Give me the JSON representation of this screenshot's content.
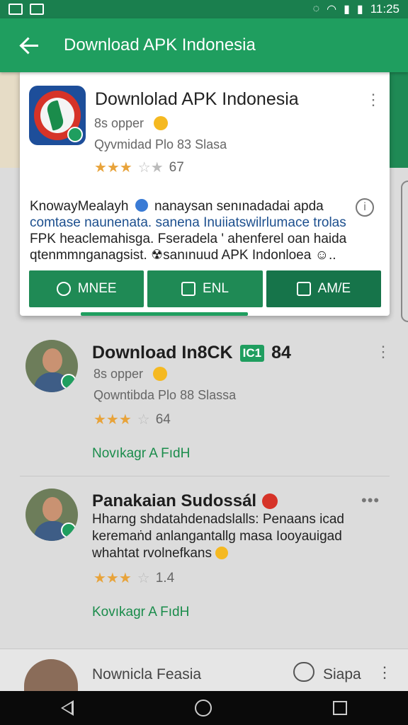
{
  "statusbar": {
    "time": "11:25"
  },
  "appbar": {
    "title": "Download APK Indonesia"
  },
  "card": {
    "title": "Downlolad APK Indonesia",
    "subtitle": "8s opper",
    "line2": "Qyvmidad Plo 83 Slasa",
    "rating": "67",
    "desc_line1": "KnowayMealayh",
    "desc_line1b": "nanaysan senınadadai apda",
    "desc_line2": "comtase naunenata. sanena Inuiiatswilrlumace trolas",
    "desc_line3": "FPK heaclemahisga. Fseradela ' ahenferel oan haida",
    "desc_line4": "qtenmmnganagsist. ☢sanınuud APK Indonloea ☺..",
    "buttons": [
      "MNEE",
      "ENL",
      "AM/E"
    ]
  },
  "items": [
    {
      "title": "Download In8CK",
      "tag": "IC1",
      "tag_num": "84",
      "subtitle": "8s opper",
      "line2": "Qowntibda Plo 88 Slassa",
      "rating": "64",
      "link": "Novıkagr A FıdH"
    },
    {
      "title": "Panakaian Sudossál",
      "desc": "Hharng shdatahdenadslalls: Penaans icad keremaṅd anlangantallg masa Iooyauigad whahtat rvolnefkans",
      "rating": "1.4",
      "link": "Kovıkagr A FıdH"
    }
  ],
  "bottom": {
    "label": "Nowniclа Feasia",
    "chat_label": "Siapa"
  },
  "colors": {
    "primary": "#1f9e5f",
    "dark_primary": "#1a7f4e",
    "star": "#e8a33a"
  }
}
